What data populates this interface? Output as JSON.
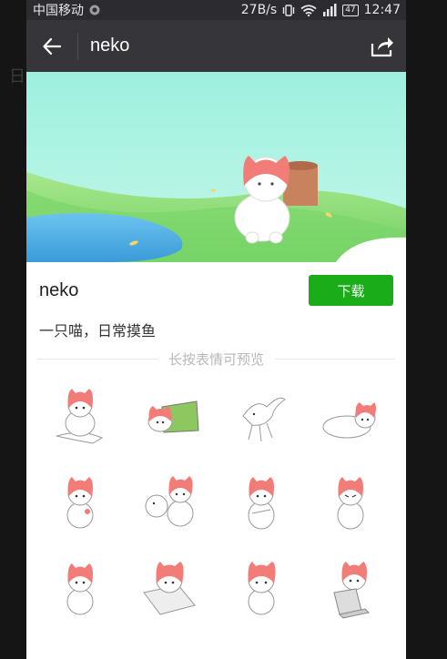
{
  "status_bar": {
    "carrier": "中国移动",
    "network_speed": "27B/s",
    "battery_level": "47",
    "time": "12:47",
    "icons": [
      "sim-icon",
      "vibrate-icon",
      "wifi-icon",
      "signal-icon",
      "battery-icon"
    ]
  },
  "nav": {
    "title": "neko",
    "back_icon": "back-arrow-icon",
    "share_icon": "share-icon"
  },
  "pack": {
    "name": "neko",
    "download_label": "下载",
    "description": "一只喵，日常摸鱼",
    "preview_hint": "长按表情可预览"
  },
  "colors": {
    "status_bg": "#2c2c30",
    "nav_bg": "#36363a",
    "download_green": "#1aad19",
    "cat_hood": "#f27d78",
    "banner_sky": "#a8f0e0",
    "banner_grass": "#8fdc7a"
  }
}
